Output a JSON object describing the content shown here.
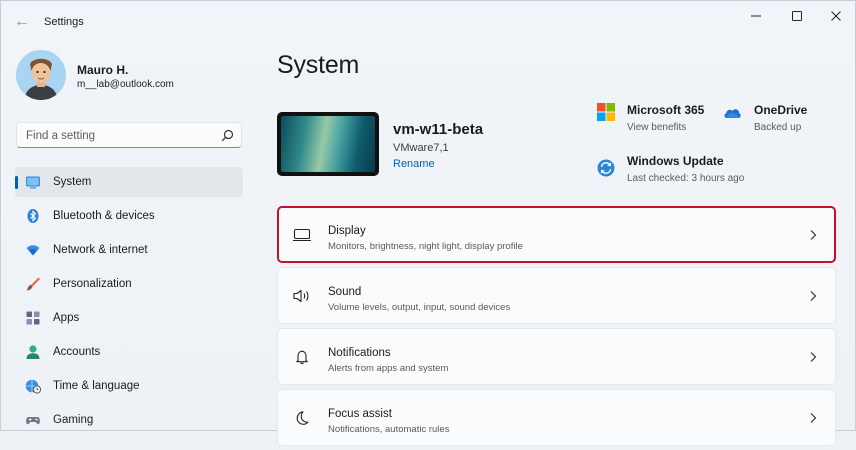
{
  "app": {
    "title": "Settings"
  },
  "profile": {
    "name": "Mauro H.",
    "email": "m__lab@outlook.com"
  },
  "search": {
    "placeholder": "Find a setting"
  },
  "nav": {
    "items": [
      {
        "label": "System",
        "icon": "system-icon",
        "active": true
      },
      {
        "label": "Bluetooth & devices",
        "icon": "bluetooth-icon"
      },
      {
        "label": "Network & internet",
        "icon": "wifi-icon"
      },
      {
        "label": "Personalization",
        "icon": "brush-icon"
      },
      {
        "label": "Apps",
        "icon": "apps-icon"
      },
      {
        "label": "Accounts",
        "icon": "accounts-icon"
      },
      {
        "label": "Time & language",
        "icon": "globe-clock-icon"
      },
      {
        "label": "Gaming",
        "icon": "gamepad-icon"
      }
    ]
  },
  "main": {
    "title": "System",
    "device": {
      "name": "vm-w11-beta",
      "model": "VMware7,1",
      "rename_label": "Rename"
    },
    "quick": [
      {
        "title": "Microsoft 365",
        "subtitle": "View benefits",
        "icon": "microsoft-logo-icon"
      },
      {
        "title": "OneDrive",
        "subtitle": "Backed up",
        "icon": "onedrive-cloud-icon"
      },
      {
        "title": "Windows Update",
        "subtitle": "Last checked: 3 hours ago",
        "icon": "windows-update-icon"
      }
    ],
    "cards": [
      {
        "title": "Display",
        "subtitle": "Monitors, brightness, night light, display profile",
        "icon": "monitor-icon",
        "highlighted": true
      },
      {
        "title": "Sound",
        "subtitle": "Volume levels, output, input, sound devices",
        "icon": "speaker-icon"
      },
      {
        "title": "Notifications",
        "subtitle": "Alerts from apps and system",
        "icon": "bell-icon"
      },
      {
        "title": "Focus assist",
        "subtitle": "Notifications, automatic rules",
        "icon": "moon-icon"
      }
    ]
  },
  "colors": {
    "accent": "#005fb8",
    "highlight_border": "#c8102e"
  }
}
